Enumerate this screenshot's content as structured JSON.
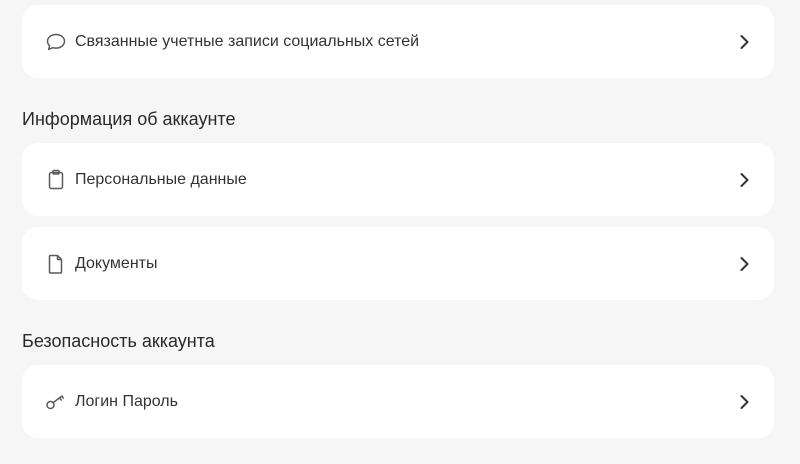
{
  "colors": {
    "background": "#f6f6f6",
    "card": "#ffffff",
    "text": "#333333",
    "icon": "#5a5a5a"
  },
  "rows": {
    "social": {
      "label": "Связанные учетные записи социальных сетей",
      "icon": "chat-bubble-icon"
    },
    "personal": {
      "label": "Персональные данные",
      "icon": "clipboard-icon"
    },
    "documents": {
      "label": "Документы",
      "icon": "document-icon"
    },
    "login": {
      "label": "Логин Пароль",
      "icon": "key-icon"
    }
  },
  "sections": {
    "account_info": {
      "title": "Информация об аккаунте"
    },
    "account_security": {
      "title": "Безопасность аккаунта"
    }
  }
}
